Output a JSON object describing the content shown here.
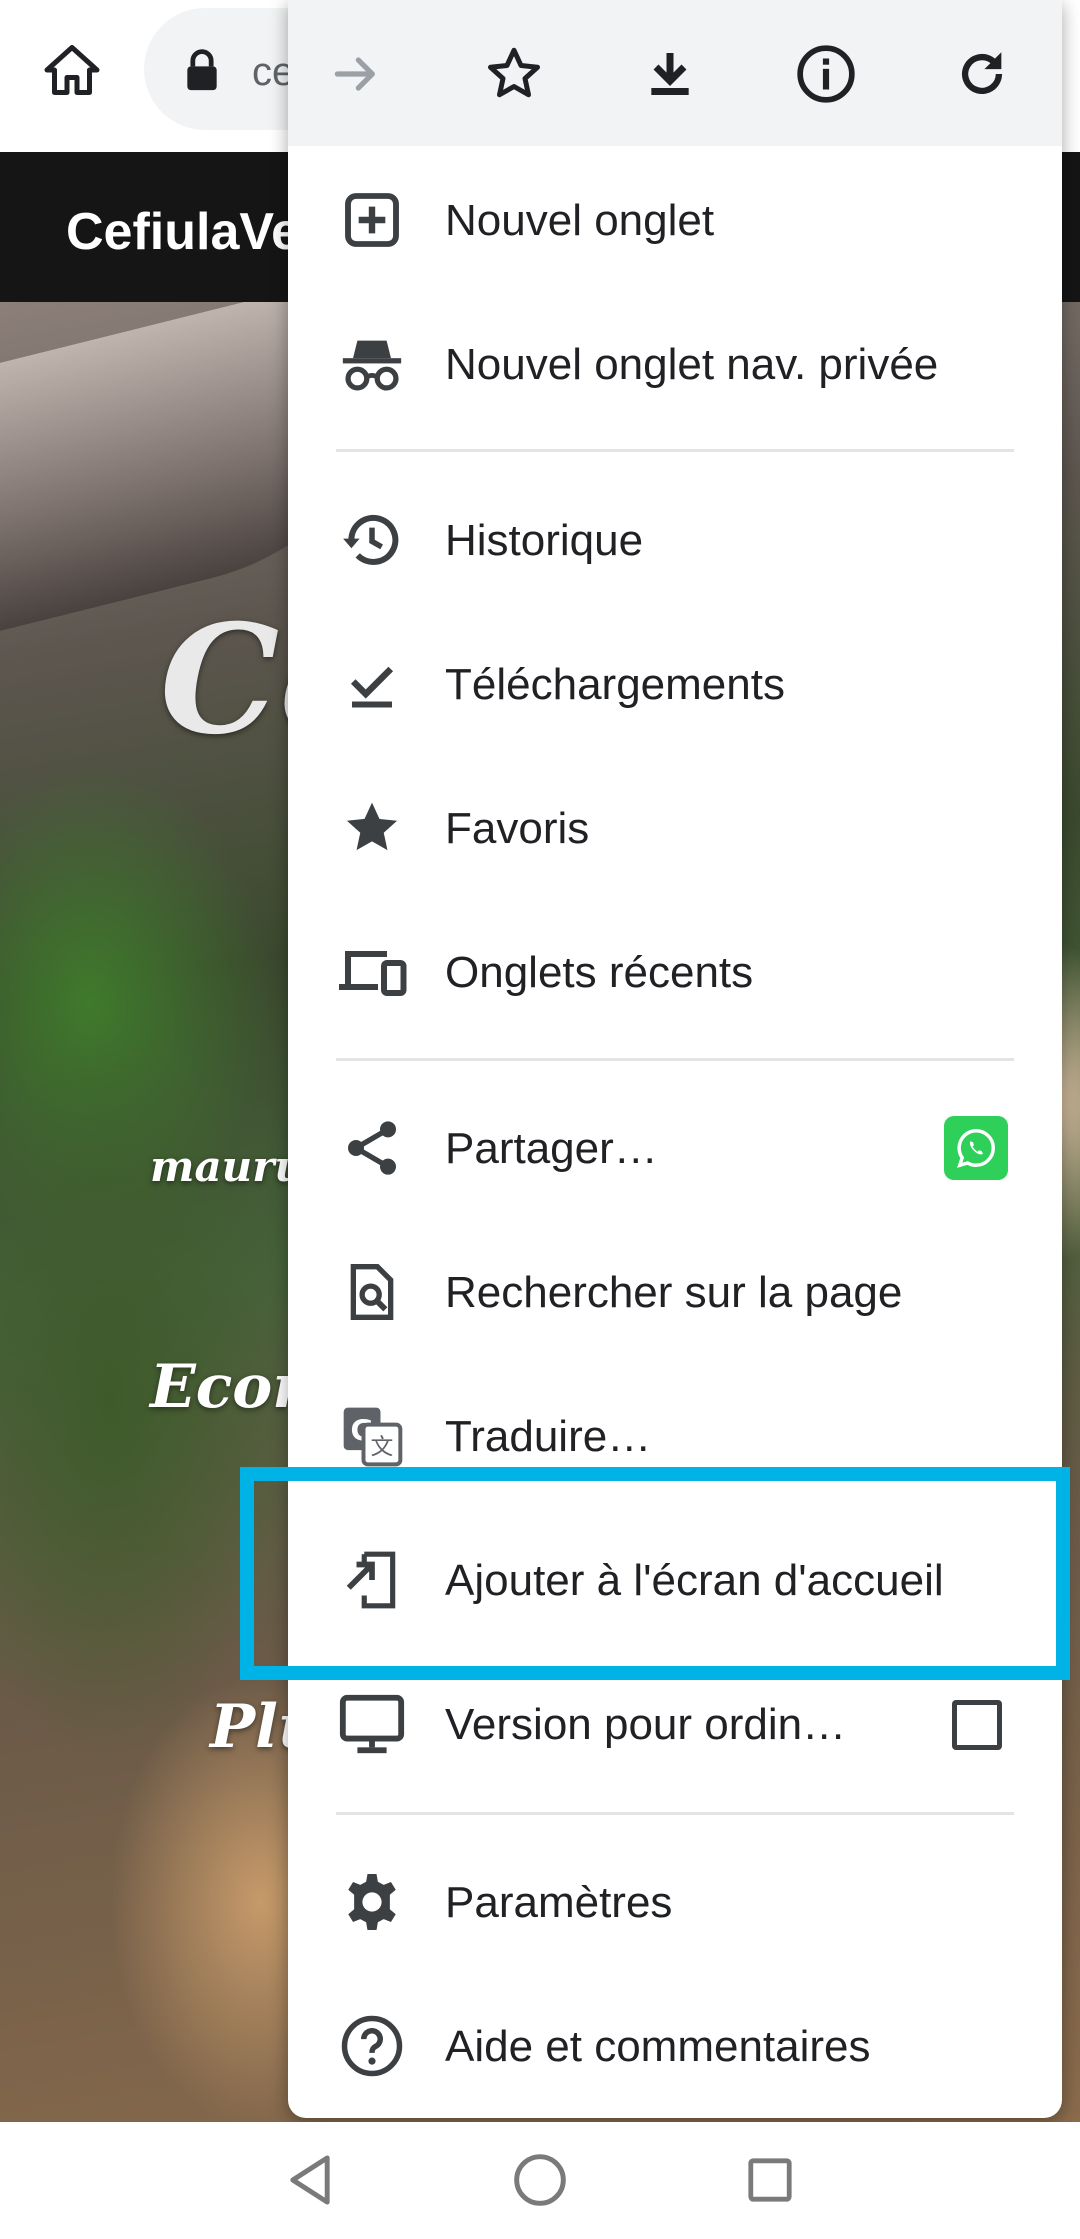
{
  "browser": {
    "url_partial": "ce",
    "toolbar_icons": [
      "home-icon",
      "lock-icon"
    ]
  },
  "site": {
    "title": "CefiulaVe",
    "hero_big": "Co",
    "hero_small": "maurun",
    "hero_mid": "Econo",
    "hero_low": "Plu"
  },
  "menu": {
    "toolbar": [
      "forward-icon",
      "bookmark-star-icon",
      "download-icon",
      "info-icon",
      "reload-icon"
    ],
    "items": [
      {
        "label": "Nouvel onglet",
        "icon": "new-tab-icon"
      },
      {
        "label": "Nouvel onglet nav. privée",
        "icon": "incognito-icon"
      },
      {
        "label": "Historique",
        "icon": "history-icon"
      },
      {
        "label": "Téléchargements",
        "icon": "downloads-icon"
      },
      {
        "label": "Favoris",
        "icon": "star-icon"
      },
      {
        "label": "Onglets récents",
        "icon": "devices-icon"
      },
      {
        "label": "Partager…",
        "icon": "share-icon"
      },
      {
        "label": "Rechercher sur la page",
        "icon": "find-in-page-icon"
      },
      {
        "label": "Traduire…",
        "icon": "translate-icon"
      },
      {
        "label": "Ajouter à l'écran d'accueil",
        "icon": "add-to-home-icon"
      },
      {
        "label": "Version pour ordin…",
        "icon": "desktop-icon",
        "checked": false
      },
      {
        "label": "Paramètres",
        "icon": "settings-icon"
      },
      {
        "label": "Aide et commentaires",
        "icon": "help-icon"
      }
    ],
    "share_app": "whatsapp-icon"
  },
  "colors": {
    "highlight": "#00b3e6",
    "whatsapp": "#2fd059",
    "icon": "#3c4043",
    "forward_disabled": "#9aa0a6"
  },
  "nav": [
    "back-icon",
    "home-circle-icon",
    "recents-icon"
  ]
}
